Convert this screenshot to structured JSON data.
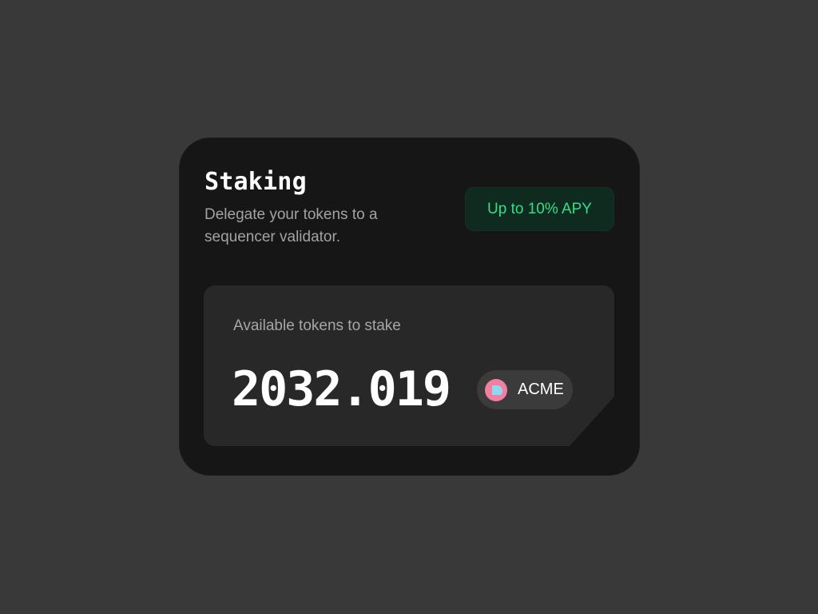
{
  "staking_card": {
    "title": "Staking",
    "description": "Delegate your tokens to a sequencer validator.",
    "apy_badge": "Up to 10% APY",
    "available": {
      "label": "Available tokens to stake",
      "amount": "2032.019",
      "token": {
        "symbol": "ACME",
        "icon": "acme-token-icon"
      }
    }
  },
  "colors": {
    "background": "#393939",
    "card": "#161616",
    "panel": "#282828",
    "accent_green": "#2fe08a",
    "badge_bg": "#0f2a1e",
    "token_pink": "#f07fa0",
    "token_blue": "#8fd8f0"
  }
}
